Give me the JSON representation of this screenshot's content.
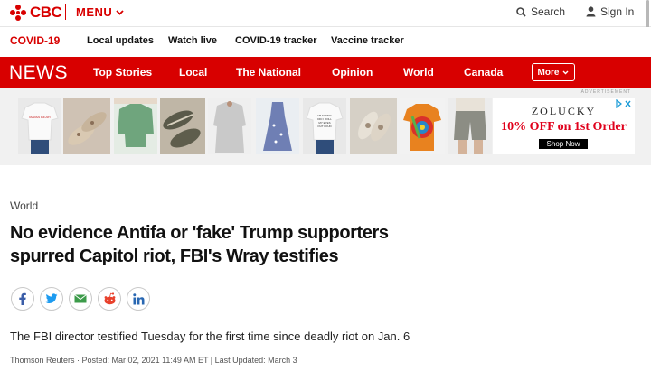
{
  "header": {
    "logo_text": "CBC",
    "menu_label": "MENU",
    "search_label": "Search",
    "signin_label": "Sign In",
    "brand_color": "#d80000"
  },
  "subnav": {
    "items": [
      "COVID-19",
      "Local updates",
      "Watch live",
      "COVID-19 tracker",
      "Vaccine tracker"
    ]
  },
  "newsbar": {
    "section_title": "NEWS",
    "items": [
      "Top Stories",
      "Local",
      "The National",
      "Opinion",
      "World",
      "Canada"
    ],
    "more_label": "More"
  },
  "ad": {
    "label": "ADVERTISEMENT",
    "brand": "ZOLUCKY",
    "offer": "10% OFF on 1st Order",
    "cta": "Shop Now",
    "adchoices_icon": "adchoices-icon",
    "tile_shirt1_text": "MAMA BEAR",
    "tile_shirt2_text": "I'M SORRY\nDID I ROLL\nMY EYES\nOUT LOUD",
    "offer_color": "#e0001b"
  },
  "article": {
    "category": "World",
    "headline_line1": "No evidence Antifa or 'fake' Trump supporters",
    "headline_line2": "spurred Capitol riot, FBI's Wray testifies",
    "deck": "The FBI director testified Tuesday for the first time since deadly riot on Jan. 6",
    "byline": "Thomson Reuters · Posted: Mar 02, 2021 11:49 AM ET | Last Updated: March 3"
  },
  "share": {
    "icons": [
      "facebook-icon",
      "twitter-icon",
      "email-icon",
      "reddit-icon",
      "linkedin-icon"
    ]
  }
}
